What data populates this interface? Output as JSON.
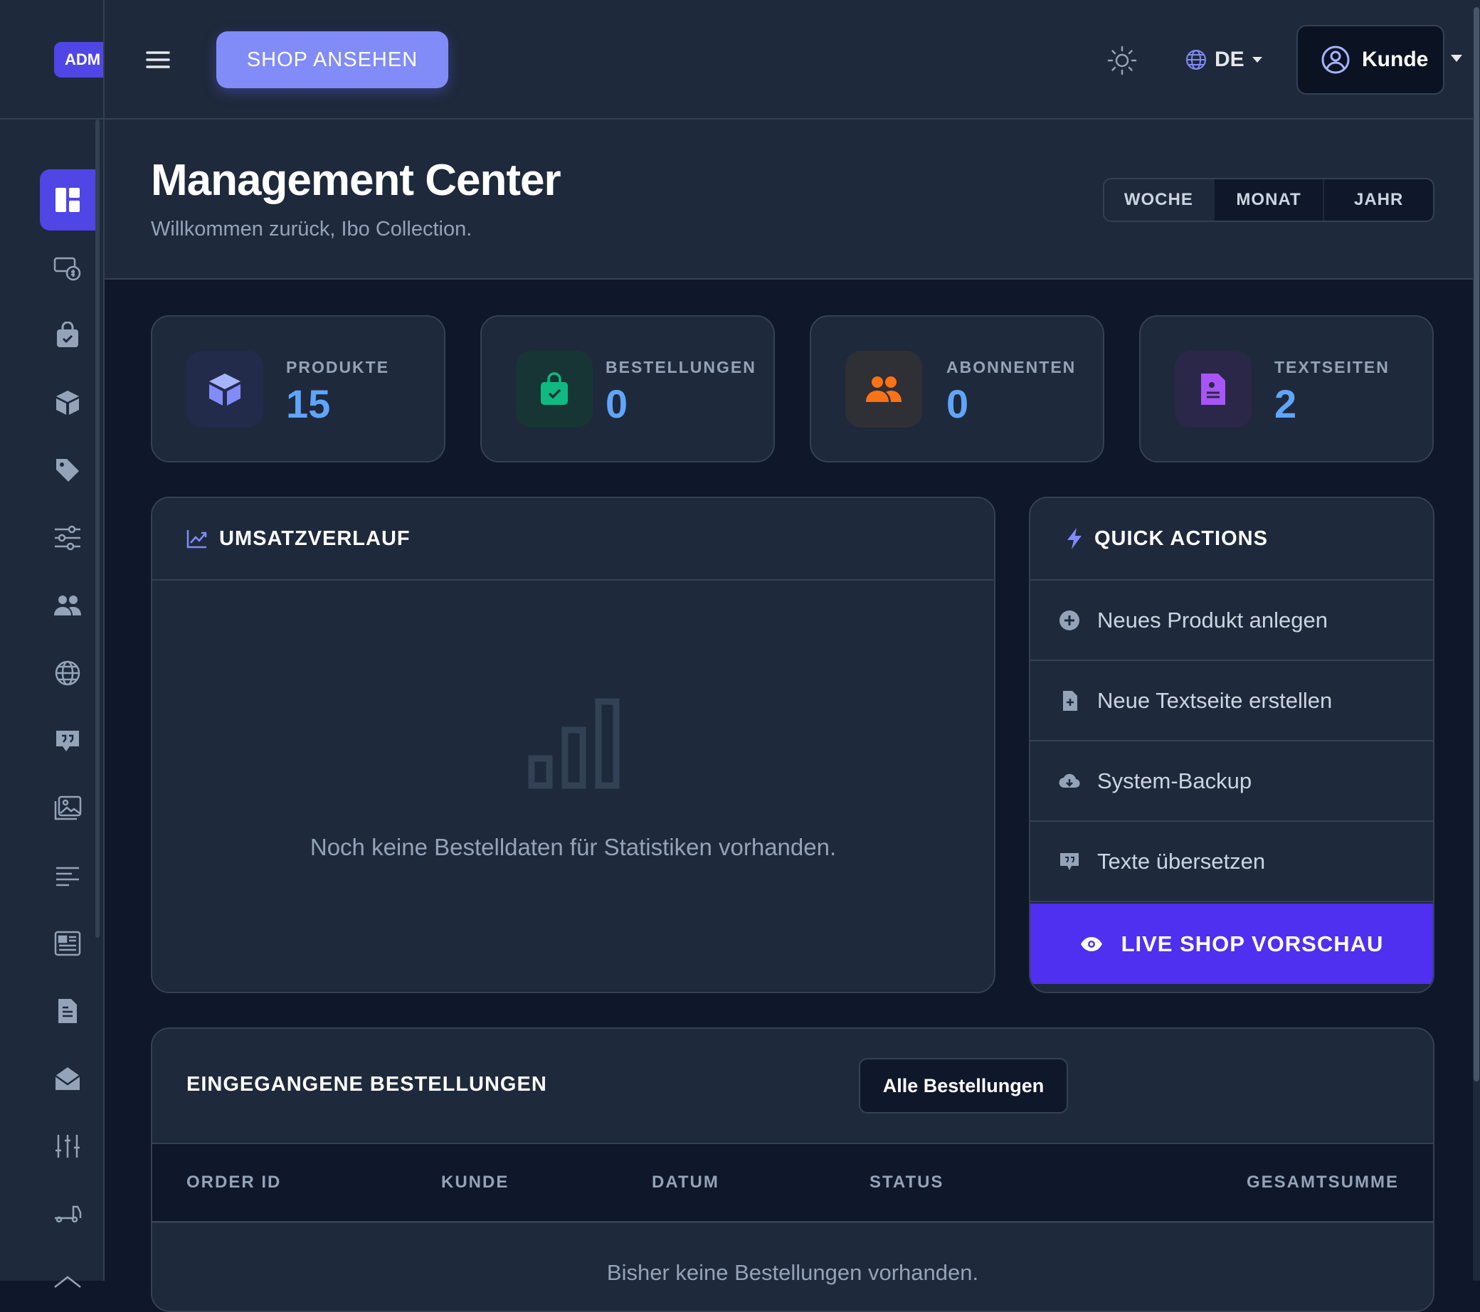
{
  "brand": {
    "badge": "ADM"
  },
  "topbar": {
    "shop_button": "SHOP ANSEHEN",
    "language": "DE",
    "user_label": "Kunde"
  },
  "sidebar": {
    "items": [
      {
        "icon": "dashboard-icon",
        "active": true
      },
      {
        "icon": "money-icon"
      },
      {
        "icon": "shopping-bag-icon"
      },
      {
        "icon": "box-icon"
      },
      {
        "icon": "tag-icon"
      },
      {
        "icon": "sliders-icon"
      },
      {
        "icon": "users-icon"
      },
      {
        "icon": "globe-icon"
      },
      {
        "icon": "quote-chat-icon"
      },
      {
        "icon": "images-icon"
      },
      {
        "icon": "text-lines-icon"
      },
      {
        "icon": "newspaper-icon"
      },
      {
        "icon": "document-icon"
      },
      {
        "icon": "mail-open-icon"
      },
      {
        "icon": "equalizer-icon"
      },
      {
        "icon": "truck-icon"
      }
    ]
  },
  "header": {
    "title": "Management Center",
    "subtitle": "Willkommen zurück, Ibo Collection.",
    "periods": [
      "WOCHE",
      "MONAT",
      "JAHR"
    ],
    "active_period": "WOCHE"
  },
  "stats": [
    {
      "label": "PRODUKTE",
      "value": "15",
      "icon": "cube-icon",
      "color": "#818cf8"
    },
    {
      "label": "BESTELLUNGEN",
      "value": "0",
      "icon": "shopping-bag-icon",
      "color": "#10b981"
    },
    {
      "label": "ABONNENTEN",
      "value": "0",
      "icon": "users-icon",
      "color": "#f97316"
    },
    {
      "label": "TEXTSEITEN",
      "value": "2",
      "icon": "document-icon",
      "color": "#a855f7"
    }
  ],
  "revenue": {
    "title": "UMSATZVERLAUF",
    "empty_message": "Noch keine Bestelldaten für Statistiken vorhanden."
  },
  "quick_actions": {
    "title": "QUICK ACTIONS",
    "items": [
      {
        "label": "Neues Produkt anlegen",
        "icon": "plus-circle-icon"
      },
      {
        "label": "Neue Textseite erstellen",
        "icon": "file-plus-icon"
      },
      {
        "label": "System-Backup",
        "icon": "cloud-download-icon"
      },
      {
        "label": "Texte übersetzen",
        "icon": "translate-chat-icon"
      }
    ],
    "live_preview": "LIVE SHOP VORSCHAU"
  },
  "orders": {
    "title": "EINGEGANGENE BESTELLUNGEN",
    "all_button": "Alle Bestellungen",
    "columns": [
      "ORDER ID",
      "KUNDE",
      "DATUM",
      "STATUS",
      "GESAMTSUMME"
    ],
    "empty_message": "Bisher keine Bestellungen vorhanden."
  },
  "colors": {
    "accent": "#4f46e5",
    "accent_light": "#818cf8",
    "value_blue": "#60a5fa",
    "bg": "#0f172a",
    "surface": "#1e293b"
  }
}
